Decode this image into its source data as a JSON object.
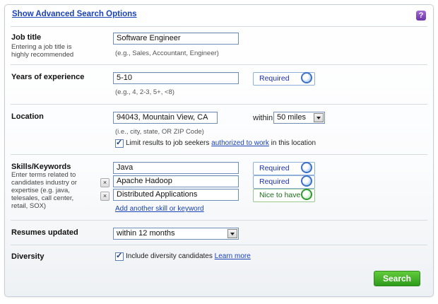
{
  "header": {
    "advanced_link": "Show Advanced Search Options",
    "help_icon": "?"
  },
  "job_title": {
    "label": "Job title",
    "sublabel_line1": "Entering a job title is",
    "sublabel_line2": "highly recommended",
    "value": "Software Engineer",
    "hint": "(e.g., Sales, Accountant, Engineer)"
  },
  "experience": {
    "label": "Years of experience",
    "value": "5-10",
    "hint": "(e.g., 4, 2-3, 5+, <8)",
    "importance": "Required"
  },
  "location": {
    "label": "Location",
    "value": "94043, Mountain View, CA",
    "within_label": "within",
    "radius": "50 miles",
    "hint": "(i.e., city, state, OR ZIP Code)",
    "authorized_prefix": "Limit results to job seekers",
    "authorized_link": "authorized to work",
    "authorized_suffix": "in this location"
  },
  "skills": {
    "label": "Skills/Keywords",
    "sublabel_lines": [
      "Enter terms related to",
      "candidates industry or",
      "expertise (e.g. java,",
      "telesales, call center,",
      "retail, SOX)"
    ],
    "items": [
      {
        "value": "Java",
        "importance": "Required"
      },
      {
        "value": "Apache Hadoop",
        "importance": "Required"
      },
      {
        "value": "Distributed Applications",
        "importance": "Nice to have"
      }
    ],
    "remove_glyph": "×",
    "add_link": "Add another skill or keyword"
  },
  "resumes": {
    "label": "Resumes updated",
    "value": "within 12 months"
  },
  "diversity": {
    "label": "Diversity",
    "checkbox_label": "Include diversity candidates",
    "learn_more": "Learn more"
  },
  "actions": {
    "search": "Search"
  },
  "colors": {
    "link": "#1a43b8",
    "search_button": "#3aa524",
    "required_knob": "#3a72c9",
    "nice_knob": "#2e9a2e"
  }
}
